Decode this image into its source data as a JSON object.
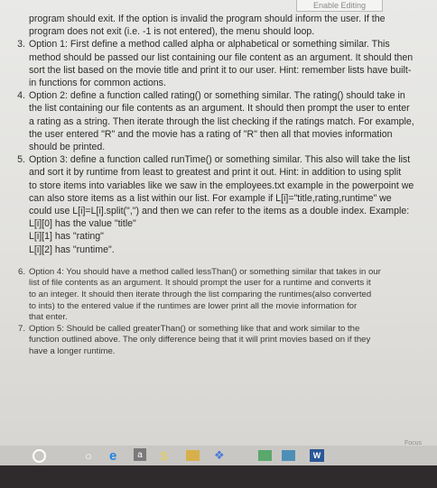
{
  "toolbar": {
    "enable_editing": "Enable Editing"
  },
  "items": [
    {
      "num": "",
      "lines": [
        "program should exit. If the option is invalid the program should inform the user. If the",
        "program does not exit (i.e. -1 is not entered), the menu should loop."
      ]
    },
    {
      "num": "3.",
      "lines": [
        "Option 1: First define a method called alpha or alphabetical or something similar. This",
        "method should be passed our list containing our file content as an argument. It should then",
        "sort the list based on the movie title and print it to our user. Hint: remember lists have built-",
        "in functions for common actions."
      ]
    },
    {
      "num": "4.",
      "lines": [
        "Option 2: define a function called rating() or something similar. The rating() should take in",
        "the list containing our file contents as an argument. It should then prompt the user to enter",
        "a rating as a string. Then iterate through the list checking if the ratings match. For example,",
        "the user entered \"R\" and the movie has a rating of \"R\" then all that movies information",
        "should be printed."
      ]
    },
    {
      "num": "5.",
      "lines": [
        "Option 3: define a function called runTime() or something similar. This also will take the list",
        "and sort it by runtime from least to greatest and print it out. Hint: in addition to using split",
        "to store items into variables like we saw in the employees.txt example in the powerpoint we",
        "can also store items as a list within our list. For example if L[i]=\"title,rating,runtime\" we",
        "could use L[i]=L[i].split(\",\") and then we can refer to the items as a double index. Example:",
        "L[i][0] has the value \"title\"",
        "L[i][1] has \"rating\"",
        "L[i][2] has \"runtime\"."
      ]
    },
    {
      "num": "6.",
      "lines": [
        "Option 4: You should have a method called lessThan() or something similar that takes in our",
        "list of file contents as an argument. It should prompt the user for a runtime and converts it",
        "to an integer. It should then iterate through the list comparing the runtimes(also converted",
        "to ints) to the entered value if the runtimes are lower print all the movie information for",
        "that enter."
      ]
    },
    {
      "num": "7.",
      "lines": [
        "Option 5: Should be called greaterThan() or something like that and work similar to the",
        "function outlined above. The only difference being that it will print movies based on if they",
        "have a longer runtime."
      ]
    }
  ],
  "status": {
    "focus": "Focus"
  },
  "taskbar": {
    "icons": [
      "start-icon",
      "cortana-icon",
      "edge-icon",
      "store-icon",
      "money-icon",
      "folder-icon",
      "dropbox-icon",
      "photos-icon",
      "word-icon"
    ],
    "store_glyph": "a",
    "money_glyph": "$",
    "word_glyph": "W"
  }
}
